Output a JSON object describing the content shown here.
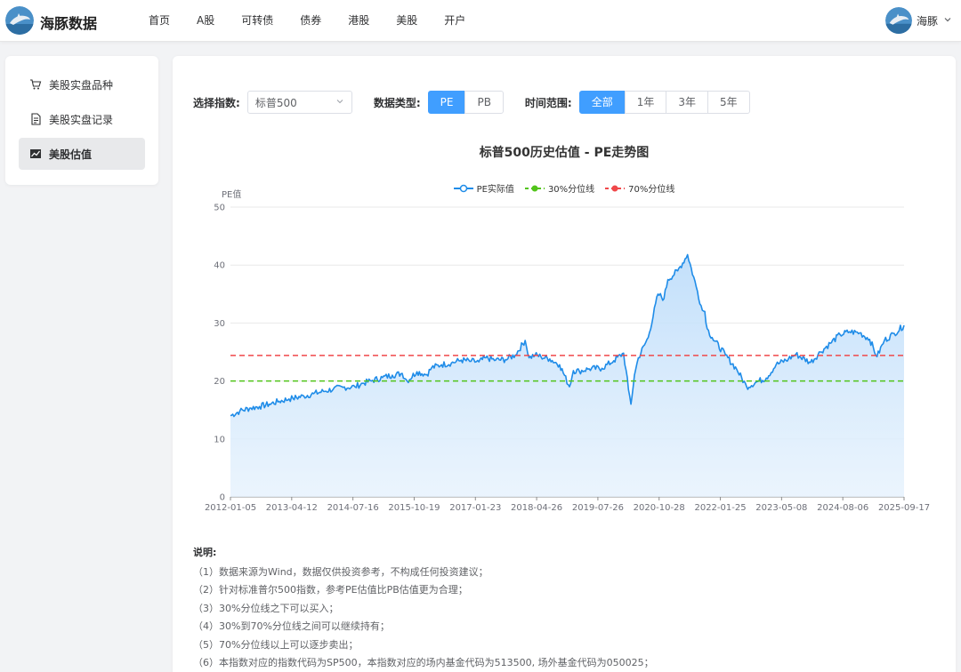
{
  "header": {
    "brand": "海豚数据",
    "nav": [
      "首页",
      "A股",
      "可转债",
      "债券",
      "港股",
      "美股",
      "开户"
    ],
    "user_name": "海豚"
  },
  "sidebar": {
    "items": [
      {
        "label": "美股实盘品种",
        "icon": "shopping-cart-icon"
      },
      {
        "label": "美股实盘记录",
        "icon": "document-icon"
      },
      {
        "label": "美股估值",
        "icon": "line-chart-icon",
        "active": true
      }
    ]
  },
  "filters": {
    "index_label": "选择指数:",
    "index_value": "标普500",
    "type_label": "数据类型:",
    "types": [
      "PE",
      "PB"
    ],
    "type_selected": "PE",
    "range_label": "时间范围:",
    "ranges": [
      "全部",
      "1年",
      "3年",
      "5年"
    ],
    "range_selected": "全部"
  },
  "colors": {
    "accent": "#409eff",
    "pe_line": "#1f8ce8",
    "p30": "#52c41a",
    "p70": "#f0484a"
  },
  "chart_data": {
    "type": "area",
    "title": "标普500历史估值 - PE走势图",
    "ylabel": "PE值",
    "xlabel": "",
    "ylim": [
      0,
      50
    ],
    "yticks": [
      0,
      10,
      20,
      30,
      40,
      50
    ],
    "xticks": [
      "2012-01-05",
      "2013-04-12",
      "2014-07-16",
      "2015-10-19",
      "2017-01-23",
      "2018-04-26",
      "2019-07-26",
      "2020-10-28",
      "2022-01-25",
      "2023-05-08",
      "2024-08-06",
      "2025-09-17"
    ],
    "legend": [
      "PE实际值",
      "30%分位线",
      "70%分位线"
    ],
    "legend_position": "top-center",
    "grid": true,
    "percentile_30": 20,
    "percentile_70": 24.4,
    "x": [
      2012.01,
      2012.2,
      2012.4,
      2012.6,
      2012.8,
      2013.0,
      2013.2,
      2013.28,
      2013.5,
      2013.7,
      2013.9,
      2014.1,
      2014.3,
      2014.54,
      2014.7,
      2014.9,
      2015.1,
      2015.3,
      2015.5,
      2015.6,
      2015.8,
      2016.0,
      2016.1,
      2016.3,
      2016.5,
      2016.7,
      2016.9,
      2017.06,
      2017.2,
      2017.4,
      2017.6,
      2017.8,
      2018.0,
      2018.08,
      2018.2,
      2018.32,
      2018.5,
      2018.7,
      2018.9,
      2018.98,
      2019.1,
      2019.3,
      2019.56,
      2019.8,
      2020.0,
      2020.1,
      2020.15,
      2020.22,
      2020.3,
      2020.5,
      2020.7,
      2020.82,
      2020.9,
      2021.1,
      2021.3,
      2021.5,
      2021.6,
      2021.65,
      2021.7,
      2021.8,
      2022.07,
      2022.3,
      2022.5,
      2022.75,
      2022.9,
      2023.1,
      2023.35,
      2023.5,
      2023.8,
      2024.0,
      2024.2,
      2024.4,
      2024.59,
      2024.8,
      2025.0,
      2025.15,
      2025.3,
      2025.5,
      2025.7
    ],
    "values": [
      14.0,
      14.8,
      15.3,
      15.6,
      16.0,
      16.5,
      16.9,
      17.0,
      17.4,
      17.8,
      18.2,
      18.6,
      18.9,
      19.0,
      19.6,
      20.1,
      20.6,
      21.0,
      21.3,
      20.0,
      21.6,
      21.1,
      22.3,
      22.8,
      23.1,
      23.6,
      23.4,
      23.3,
      24.0,
      23.6,
      23.7,
      24.5,
      27.0,
      24.0,
      24.5,
      24.2,
      23.8,
      22.8,
      19.0,
      21.8,
      21.7,
      22.1,
      22.2,
      23.5,
      24.8,
      18.5,
      16.0,
      21.0,
      24.0,
      27.5,
      35.0,
      34.2,
      37.5,
      39.0,
      41.8,
      35.5,
      32.2,
      32.0,
      29.0,
      27.5,
      24.5,
      22.0,
      19.0,
      20.0,
      20.5,
      22.8,
      23.8,
      24.6,
      23.2,
      25.0,
      26.5,
      28.0,
      28.5,
      28.3,
      27.2,
      24.2,
      27.0,
      28.2,
      29.6
    ]
  },
  "notes": {
    "title": "说明:",
    "lines": [
      "（1）数据来源为Wind，数据仅供投资参考，不构成任何投资建议；",
      "（2）针对标准普尔500指数，参考PE估值比PB估值更为合理；",
      "（3）30%分位线之下可以买入；",
      "（4）30%到70%分位线之间可以继续持有；",
      "（5）70%分位线以上可以逐步卖出；",
      "（6）本指数对应的指数代码为SP500，本指数对应的场内基金代码为513500, 场外基金代码为050025；"
    ]
  }
}
